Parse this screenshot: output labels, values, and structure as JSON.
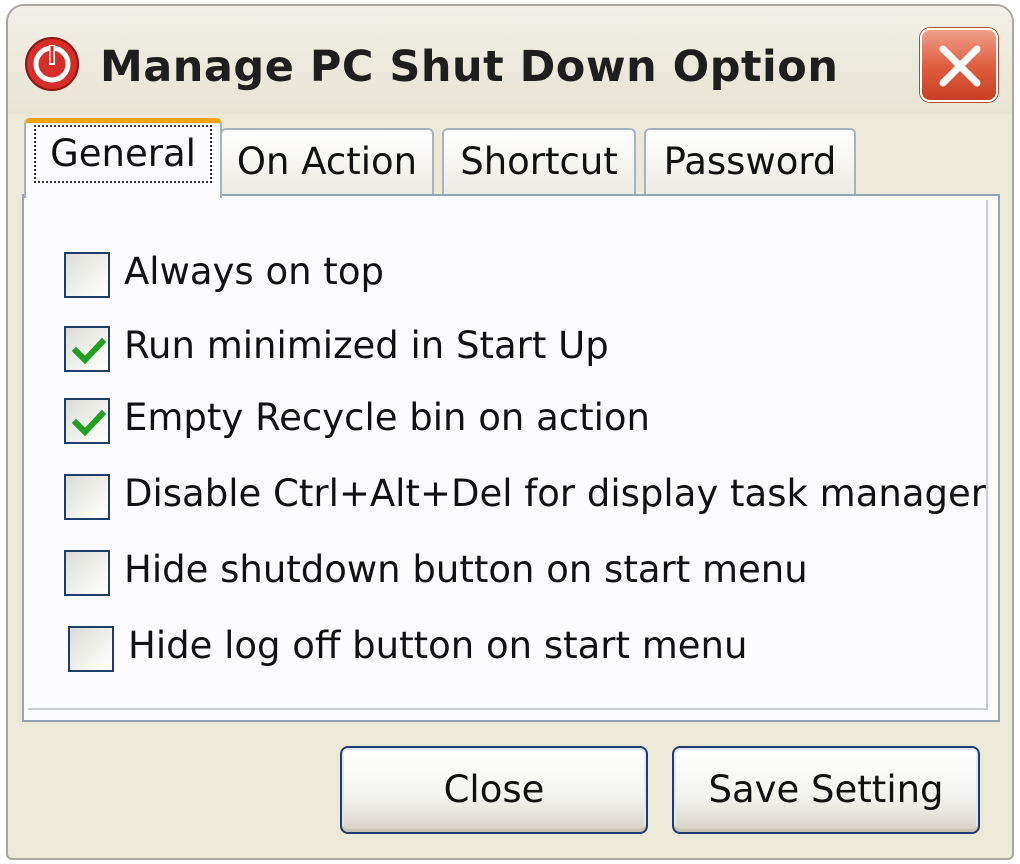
{
  "window": {
    "title": "Manage PC Shut Down Option",
    "icon": "power-icon",
    "close_icon": "close-icon"
  },
  "tabs": [
    {
      "label": "General",
      "active": true
    },
    {
      "label": "On Action",
      "active": false
    },
    {
      "label": "Shortcut",
      "active": false
    },
    {
      "label": "Password",
      "active": false
    }
  ],
  "options": [
    {
      "label": "Always on top",
      "checked": false
    },
    {
      "label": "Run minimized in Start Up",
      "checked": true
    },
    {
      "label": "Empty Recycle bin on action",
      "checked": true
    },
    {
      "label": "Disable Ctrl+Alt+Del for display task manager",
      "checked": false
    },
    {
      "label": "Hide shutdown button on start menu",
      "checked": false
    },
    {
      "label": "Hide log off button on start menu",
      "checked": false
    }
  ],
  "buttons": {
    "close": "Close",
    "save": "Save Setting"
  },
  "colors": {
    "titlebar": "#ece9d8",
    "close_button": "#df5a3c",
    "active_tab_accent": "#f6a30a",
    "checkmark": "#21a121",
    "border": "#1f3d74"
  }
}
